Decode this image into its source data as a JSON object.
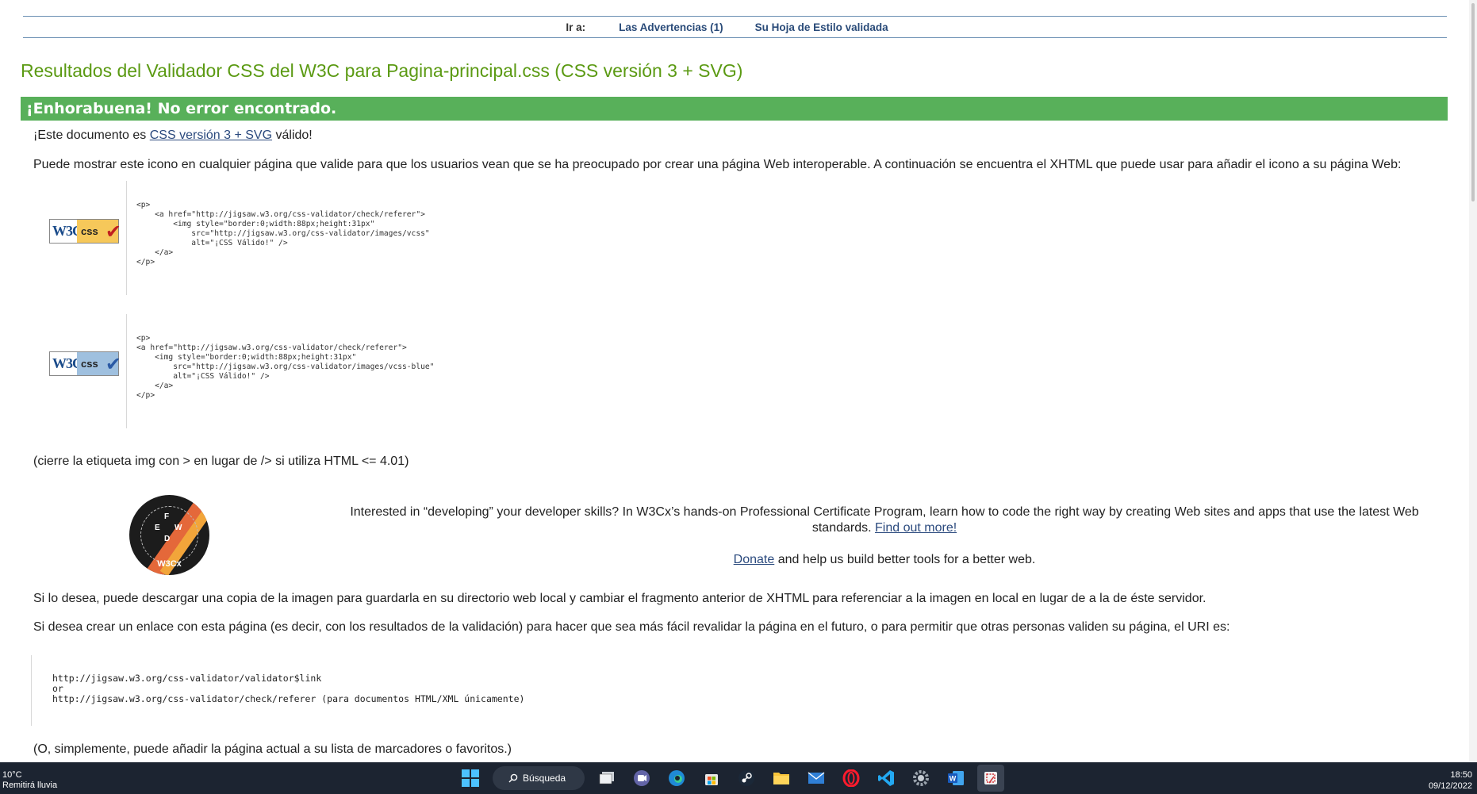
{
  "jumpbar": {
    "label": "Ir a:",
    "links": [
      "Las Advertencias (1)",
      "Su Hoja de Estilo validada"
    ]
  },
  "title": "Resultados del Validador CSS del W3C para Pagina-principal.css (CSS versión 3 + SVG)",
  "congrats": "¡Enhorabuena! No error encontrado.",
  "valid_line": {
    "prefix": "¡Este documento es ",
    "link": "CSS versión 3 + SVG",
    "suffix": " válido!"
  },
  "icon_intro": "Puede mostrar este icono en cualquier página que valide para que los usuarios vean que se ha preocupado por crear una página Web interoperable. A continuación se encuentra el XHTML que puede usar para añadir el icono a su página Web:",
  "badges": {
    "w3c": "W3C",
    "css": "css",
    "check": "✔"
  },
  "code_gold": "<p>\n    <a href=\"http://jigsaw.w3.org/css-validator/check/referer\">\n        <img style=\"border:0;width:88px;height:31px\"\n            src=\"http://jigsaw.w3.org/css-validator/images/vcss\"\n            alt=\"¡CSS Válido!\" />\n    </a>\n</p>",
  "code_blue": "<p>\n<a href=\"http://jigsaw.w3.org/css-validator/check/referer\">\n    <img style=\"border:0;width:88px;height:31px\"\n        src=\"http://jigsaw.w3.org/css-validator/images/vcss-blue\"\n        alt=\"¡CSS Válido!\" />\n    </a>\n</p>",
  "close_note": "(cierre la etiqueta img con > en lugar de /> si utiliza HTML <= 4.01)",
  "promo": {
    "logo_brand": "W3Cx",
    "text": "Interested in “developing” your developer skills? In W3Cx’s hands-on Professional Certificate Program, learn how to code the right way by creating Web sites and apps that use the latest Web standards. ",
    "link": "Find out more!",
    "donate_link": "Donate",
    "donate_text": " and help us build better tools for a better web."
  },
  "download_text": "Si lo desea, puede descargar una copia de la imagen para guardarla en su directorio web local y cambiar el fragmento anterior de XHTML para referenciar a la imagen en local en lugar de a la de éste servidor.",
  "link_text": "Si desea crear un enlace con esta página (es decir, con los resultados de la validación) para hacer que sea más fácil revalidar la página en el futuro, o para permitir que otras personas validen su página, el URI es:",
  "uri_code": "http://jigsaw.w3.org/css-validator/validator$link\nor\nhttp://jigsaw.w3.org/css-validator/check/referer (para documentos HTML/XML únicamente)",
  "bookmark_text": "(O, simplemente, puede añadir la página actual a su lista de marcadores o favoritos.)",
  "taskbar": {
    "weather_temp": "10°C",
    "weather_desc": "Remitirá lluvia",
    "search_label": "Búsqueda",
    "time": "18:50",
    "date": "09/12/2022",
    "apps": [
      "task-view",
      "teams",
      "edge",
      "store",
      "steam",
      "file-explorer",
      "mail",
      "opera",
      "vscode",
      "settings",
      "word",
      "snipping-tool"
    ]
  }
}
